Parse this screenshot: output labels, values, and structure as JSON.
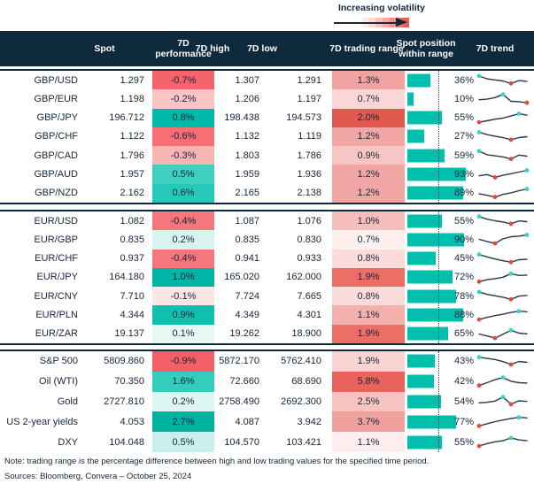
{
  "legend": {
    "label": "Increasing volatility"
  },
  "colors": {
    "header_bg": "#0f2a3d",
    "text": "#15263b",
    "bar": "#00bfad",
    "spark_line": "#25384f",
    "spark_max": "#36d3c6",
    "spark_min": "#e2493d",
    "volatility_gradient_end": "#e85c52"
  },
  "chart_data": {
    "type": "table",
    "columns": [
      "Spot",
      "7D performance",
      "7D high",
      "7D low",
      "7D trading range",
      "Spot position within range",
      "7D trend"
    ],
    "legend_note": "Increasing volatility",
    "position_scale": {
      "min": 0,
      "max": 100,
      "reference_line_pct": 50
    },
    "sections": [
      {
        "rows": [
          {
            "label": "GBP/USD",
            "spot": "1.297",
            "perf": "-0.7%",
            "perf_bg": "#f4646c",
            "high": "1.307",
            "low": "1.291",
            "range": "1.3%",
            "range_bg": "#f0a3a0",
            "position": "36%",
            "position_pct": 36,
            "trend": [
              0.88,
              0.62,
              0.52,
              0.42,
              0.18,
              0.45,
              0.38
            ],
            "trend_max": 0,
            "trend_min": 4
          },
          {
            "label": "GBP/EUR",
            "spot": "1.198",
            "perf": "-0.2%",
            "perf_bg": "#f9c4c3",
            "high": "1.206",
            "low": "1.197",
            "range": "0.7%",
            "range_bg": "#fad7d6",
            "position": "10%",
            "position_pct": 10,
            "trend": [
              0.4,
              0.45,
              0.6,
              0.9,
              0.25,
              0.22,
              0.12
            ],
            "trend_max": 3,
            "trend_min": 6
          },
          {
            "label": "GBP/JPY",
            "spot": "196.712",
            "perf": "0.8%",
            "perf_bg": "#00baa9",
            "high": "198.438",
            "low": "194.573",
            "range": "2.0%",
            "range_bg": "#e15a50",
            "position": "55%",
            "position_pct": 55,
            "trend": [
              0.12,
              0.25,
              0.4,
              0.5,
              0.7,
              0.92,
              0.78
            ],
            "trend_max": 5,
            "trend_min": 0
          },
          {
            "label": "GBP/CHF",
            "spot": "1.122",
            "perf": "-0.6%",
            "perf_bg": "#f56f74",
            "high": "1.132",
            "low": "1.119",
            "range": "1.2%",
            "range_bg": "#f1a6a4",
            "position": "27%",
            "position_pct": 27,
            "trend": [
              0.92,
              0.7,
              0.55,
              0.42,
              0.22,
              0.42,
              0.5
            ],
            "trend_max": 0,
            "trend_min": 4
          },
          {
            "label": "GBP/CAD",
            "spot": "1.796",
            "perf": "-0.3%",
            "perf_bg": "#f8b4b3",
            "high": "1.803",
            "low": "1.786",
            "range": "0.9%",
            "range_bg": "#f7c6c4",
            "position": "59%",
            "position_pct": 59,
            "trend": [
              0.88,
              0.55,
              0.45,
              0.35,
              0.15,
              0.52,
              0.42
            ],
            "trend_max": 0,
            "trend_min": 4
          },
          {
            "label": "GBP/AUD",
            "spot": "1.957",
            "perf": "0.5%",
            "perf_bg": "#3dd0c1",
            "high": "1.959",
            "low": "1.936",
            "range": "1.2%",
            "range_bg": "#f1a6a4",
            "position": "93%",
            "position_pct": 93,
            "trend": [
              0.4,
              0.52,
              0.25,
              0.45,
              0.6,
              0.75,
              0.92
            ],
            "trend_max": 6,
            "trend_min": 2
          },
          {
            "label": "GBP/NZD",
            "spot": "2.162",
            "perf": "0.6%",
            "perf_bg": "#26c9b9",
            "high": "2.165",
            "low": "2.138",
            "range": "1.2%",
            "range_bg": "#f1a6a4",
            "position": "89%",
            "position_pct": 89,
            "trend": [
              0.45,
              0.32,
              0.15,
              0.4,
              0.55,
              0.75,
              0.9
            ],
            "trend_max": 6,
            "trend_min": 2
          }
        ]
      },
      {
        "rows": [
          {
            "label": "EUR/USD",
            "spot": "1.082",
            "perf": "-0.4%",
            "perf_bg": "#f5767b",
            "high": "1.087",
            "low": "1.076",
            "range": "1.0%",
            "range_bg": "#f5bdbb",
            "position": "55%",
            "position_pct": 55,
            "trend": [
              0.9,
              0.65,
              0.5,
              0.38,
              0.22,
              0.48,
              0.42
            ],
            "trend_max": 0,
            "trend_min": 4
          },
          {
            "label": "EUR/GBP",
            "spot": "0.835",
            "perf": "0.2%",
            "perf_bg": "#d7f4ef",
            "high": "0.835",
            "low": "0.830",
            "range": "0.7%",
            "range_bg": "#fdf0ef",
            "position": "90%",
            "position_pct": 90,
            "trend": [
              0.5,
              0.3,
              0.12,
              0.55,
              0.75,
              0.8,
              0.92
            ],
            "trend_max": 6,
            "trend_min": 2
          },
          {
            "label": "EUR/CHF",
            "spot": "0.937",
            "perf": "-0.4%",
            "perf_bg": "#f5767b",
            "high": "0.941",
            "low": "0.933",
            "range": "0.8%",
            "range_bg": "#fbdcda",
            "position": "45%",
            "position_pct": 45,
            "trend": [
              0.9,
              0.68,
              0.48,
              0.32,
              0.18,
              0.42,
              0.45
            ],
            "trend_max": 0,
            "trend_min": 4
          },
          {
            "label": "EUR/JPY",
            "spot": "164.180",
            "perf": "1.0%",
            "perf_bg": "#00b5a3",
            "high": "165.020",
            "low": "162.000",
            "range": "1.9%",
            "range_bg": "#ed6e67",
            "position": "72%",
            "position_pct": 72,
            "trend": [
              0.1,
              0.28,
              0.38,
              0.52,
              0.85,
              0.68,
              0.72
            ],
            "trend_max": 4,
            "trend_min": 0
          },
          {
            "label": "EUR/CNY",
            "spot": "7.710",
            "perf": "-0.1%",
            "perf_bg": "#fce6e5",
            "high": "7.724",
            "low": "7.665",
            "range": "0.8%",
            "range_bg": "#fbdcda",
            "position": "78%",
            "position_pct": 78,
            "trend": [
              0.88,
              0.65,
              0.52,
              0.38,
              0.18,
              0.48,
              0.55
            ],
            "trend_max": 0,
            "trend_min": 4
          },
          {
            "label": "EUR/PLN",
            "spot": "4.344",
            "perf": "0.9%",
            "perf_bg": "#10c0ae",
            "high": "4.349",
            "low": "4.301",
            "range": "1.1%",
            "range_bg": "#f4b0ad",
            "position": "88%",
            "position_pct": 88,
            "trend": [
              0.12,
              0.32,
              0.48,
              0.62,
              0.78,
              0.9,
              0.85
            ],
            "trend_max": 5,
            "trend_min": 0
          },
          {
            "label": "EUR/ZAR",
            "spot": "19.137",
            "perf": "0.1%",
            "perf_bg": "#e5f8f4",
            "high": "19.262",
            "low": "18.900",
            "range": "1.9%",
            "range_bg": "#ed6e67",
            "position": "65%",
            "position_pct": 65,
            "trend": [
              0.5,
              0.32,
              0.12,
              0.48,
              0.85,
              0.58,
              0.52
            ],
            "trend_max": 4,
            "trend_min": 2
          }
        ]
      },
      {
        "rows": [
          {
            "label": "S&P 500",
            "spot": "5809.860",
            "perf": "-0.9%",
            "perf_bg": "#f45f66",
            "high": "5872.170",
            "low": "5762.410",
            "range": "1.9%",
            "range_bg": "#fad4d2",
            "position": "43%",
            "position_pct": 43,
            "trend": [
              0.9,
              0.78,
              0.68,
              0.48,
              0.22,
              0.5,
              0.42
            ],
            "trend_max": 0,
            "trend_min": 4
          },
          {
            "label": "Oil (WTI)",
            "spot": "70.350",
            "perf": "1.6%",
            "perf_bg": "#33ccbd",
            "high": "72.660",
            "low": "68.690",
            "range": "5.8%",
            "range_bg": "#e9635b",
            "position": "42%",
            "position_pct": 42,
            "trend": [
              0.15,
              0.42,
              0.7,
              0.9,
              0.55,
              0.42,
              0.38
            ],
            "trend_max": 3,
            "trend_min": 0
          },
          {
            "label": "Gold",
            "spot": "2727.810",
            "perf": "0.2%",
            "perf_bg": "#def6f1",
            "high": "2758.490",
            "low": "2692.300",
            "range": "2.5%",
            "range_bg": "#f8c3c0",
            "position": "54%",
            "position_pct": 54,
            "trend": [
              0.35,
              0.4,
              0.52,
              0.9,
              0.22,
              0.55,
              0.48
            ],
            "trend_max": 3,
            "trend_min": 4
          },
          {
            "label": "US 2-year yields",
            "spot": "4.053",
            "perf": "2.7%",
            "perf_bg": "#00b19e",
            "high": "4.087",
            "low": "3.942",
            "range": "3.7%",
            "range_bg": "#f1a19d",
            "position": "77%",
            "position_pct": 77,
            "trend": [
              0.1,
              0.3,
              0.5,
              0.65,
              0.8,
              0.9,
              0.85
            ],
            "trend_max": 5,
            "trend_min": 0
          },
          {
            "label": "DXY",
            "spot": "104.048",
            "perf": "0.5%",
            "perf_bg": "#c8f0ea",
            "high": "104.570",
            "low": "103.421",
            "range": "1.1%",
            "range_bg": "#fdeeed",
            "position": "55%",
            "position_pct": 55,
            "trend": [
              0.12,
              0.35,
              0.52,
              0.62,
              0.88,
              0.7,
              0.62
            ],
            "trend_max": 4,
            "trend_min": 0
          }
        ]
      }
    ]
  },
  "footer": {
    "note": "Note: trading range is the percentage difference between high and low trading values for the specified time period.",
    "sources": "Sources: Bloomberg, Convera – October 25, 2024"
  }
}
